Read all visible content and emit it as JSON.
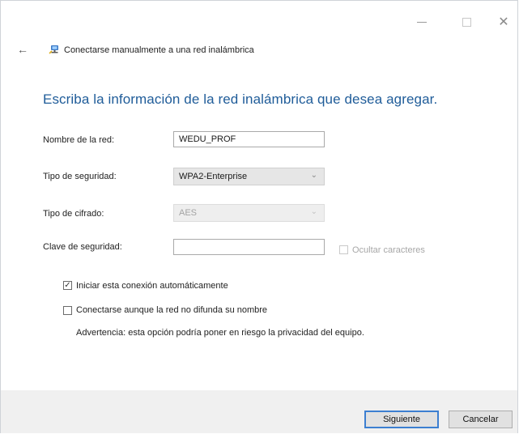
{
  "window": {
    "minimize_glyph": "—",
    "close_glyph": "✕"
  },
  "header": {
    "back_glyph": "←",
    "title": "Conectarse manualmente a una red inalámbrica",
    "icon": "network-icon"
  },
  "main": {
    "heading": "Escriba la información de la red inalámbrica que desea agregar."
  },
  "form": {
    "network_name_label": "Nombre de la red:",
    "network_name_value": "WEDU_PROF",
    "security_type_label": "Tipo de seguridad:",
    "security_type_value": "WPA2-Enterprise",
    "encryption_type_label": "Tipo de cifrado:",
    "encryption_type_value": "AES",
    "security_key_label": "Clave de seguridad:",
    "security_key_value": "",
    "hide_chars_label": "Ocultar caracteres",
    "chevron_glyph": "⌄"
  },
  "options": {
    "auto_connect_label": "Iniciar esta conexión automáticamente",
    "auto_connect_checked": true,
    "connect_hidden_label": "Conectarse aunque la red no difunda su nombre",
    "connect_hidden_checked": false,
    "warning_text": "Advertencia: esta opción podría poner en riesgo la privacidad del equipo.",
    "check_glyph": "✓"
  },
  "footer": {
    "next_label": "Siguiente",
    "cancel_label": "Cancelar"
  },
  "colors": {
    "heading": "#1f5c99",
    "default_button_border": "#3c7fd1",
    "footer_bg": "#f0f0f0"
  }
}
